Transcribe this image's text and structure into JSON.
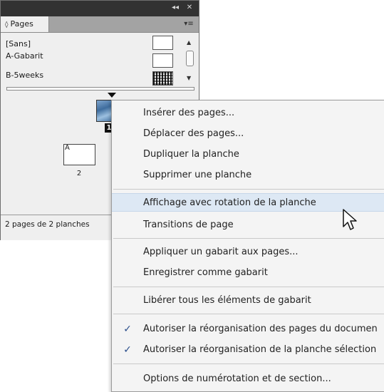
{
  "panel": {
    "collapse_glyph": "◂◂",
    "close_glyph": "✕",
    "tab_label": "Pages",
    "tab_arrows": "◊",
    "menu_glyph": "▾≡",
    "masters": [
      {
        "label": "[Sans]"
      },
      {
        "label": "A-Gabarit"
      },
      {
        "label": "B-5weeks"
      }
    ],
    "pages": [
      {
        "number": "1",
        "master_letter": ""
      },
      {
        "number": "2",
        "master_letter": "A"
      }
    ],
    "status": "2 pages de 2 planches",
    "icons": {
      "scroll_up": "▲",
      "scroll_down": "▼"
    }
  },
  "context_menu": {
    "items": [
      {
        "label": "Insérer des pages...",
        "checked": false,
        "highlighted": false
      },
      {
        "label": "Déplacer des pages...",
        "checked": false,
        "highlighted": false
      },
      {
        "label": "Dupliquer la planche",
        "checked": false,
        "highlighted": false
      },
      {
        "label": "Supprimer une planche",
        "checked": false,
        "highlighted": false
      },
      {
        "label": "Affichage avec rotation de la planche",
        "checked": false,
        "highlighted": true
      },
      {
        "label": "Transitions de page",
        "checked": false,
        "highlighted": false
      },
      {
        "label": "Appliquer un gabarit aux pages...",
        "checked": false,
        "highlighted": false
      },
      {
        "label": "Enregistrer comme gabarit",
        "checked": false,
        "highlighted": false
      },
      {
        "label": "Libérer tous les éléments de gabarit",
        "checked": false,
        "highlighted": false
      },
      {
        "label": "Autoriser la réorganisation des pages du documen",
        "checked": true,
        "highlighted": false
      },
      {
        "label": "Autoriser la réorganisation de la planche sélection",
        "checked": true,
        "highlighted": false
      },
      {
        "label": "Options de numérotation et de section...",
        "checked": false,
        "highlighted": false
      }
    ],
    "check_glyph": "✓"
  },
  "colors": {
    "highlight": "#dde8f4",
    "check": "#2c4f8c",
    "panel_bg": "#efefef",
    "title_strip": "#323232"
  }
}
